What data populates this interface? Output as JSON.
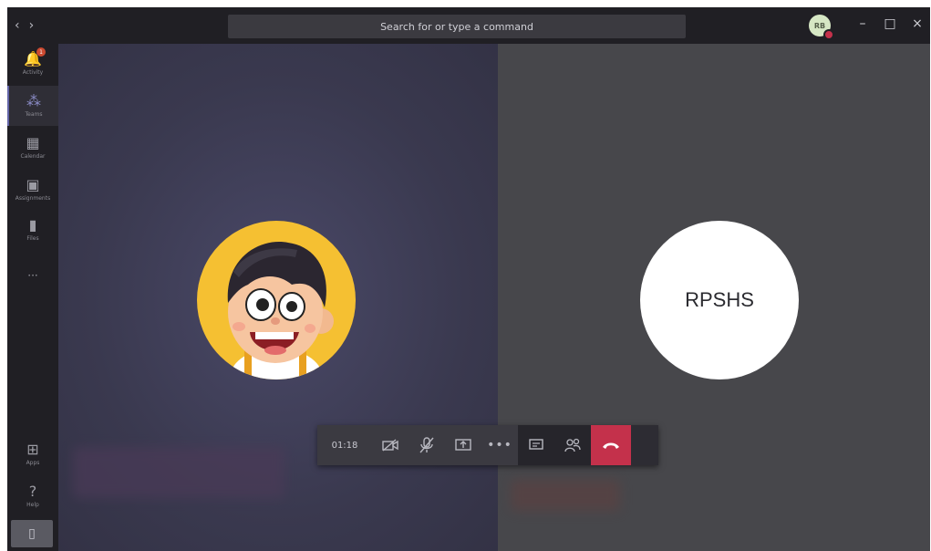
{
  "titlebar": {
    "search_placeholder": "Search for or type a command",
    "user_initials": "RB",
    "minimize": "–",
    "maximize": "□",
    "close": "×"
  },
  "rail": {
    "activity": {
      "label": "Activity",
      "badge": "1"
    },
    "teams": {
      "label": "Teams"
    },
    "calendar": {
      "label": "Calendar"
    },
    "assignments": {
      "label": "Assignments"
    },
    "files": {
      "label": "Files"
    },
    "more": "···",
    "apps": {
      "label": "Apps"
    },
    "help": {
      "label": "Help"
    }
  },
  "call": {
    "participant_right": "RPSHS",
    "timer": "01:18"
  },
  "colors": {
    "accent": "#6264a7",
    "hangup": "#c4314b"
  }
}
